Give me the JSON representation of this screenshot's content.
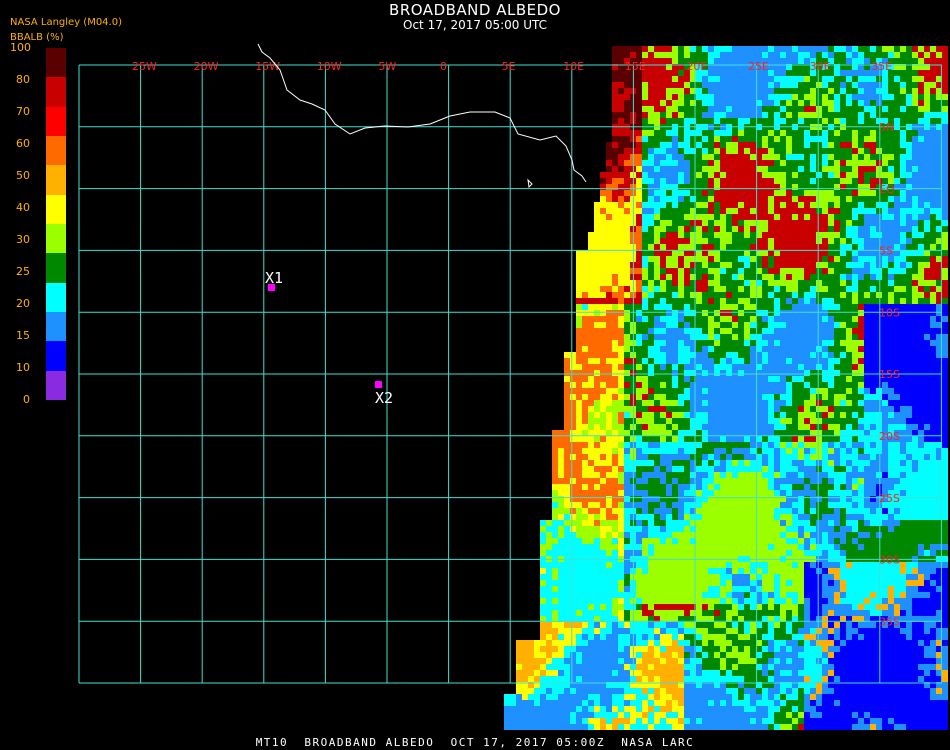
{
  "header": {
    "title": "BROADBAND ALBEDO",
    "subtitle": "Oct 17, 2017 05:00 UTC",
    "agency": "NASA Langley (M04.0)",
    "units_label": "BBALB (%)"
  },
  "legend": {
    "levels": [
      "100",
      "80",
      "70",
      "60",
      "50",
      "40",
      "30",
      "25",
      "20",
      "15",
      "10",
      "0"
    ],
    "colors": [
      "#5a0000",
      "#c80000",
      "#ff0000",
      "#ff6a00",
      "#ffb000",
      "#ffff00",
      "#9cff00",
      "#008800",
      "#00ffff",
      "#1e90ff",
      "#0000ff",
      "#8a2be2"
    ]
  },
  "grid": {
    "lon_labels": [
      "25W",
      "20W",
      "15W",
      "10W",
      "5W",
      "0",
      "5E",
      "10E",
      "15E",
      "20E",
      "25E",
      "30E",
      "35E"
    ],
    "lat_labels": [
      "5N",
      "EQ",
      "5S",
      "10S",
      "15S",
      "20S",
      "25S",
      "30S",
      "35S"
    ],
    "lines_color": "#40e0d0",
    "label_color": "#ff2020"
  },
  "markers": [
    {
      "label": "X1",
      "color": "#ff00ff"
    },
    {
      "label": "X2",
      "color": "#ff00ff"
    }
  ],
  "footer": "MT10  BROADBAND ALBEDO  OCT 17, 2017 05:00Z  NASA LARC"
}
